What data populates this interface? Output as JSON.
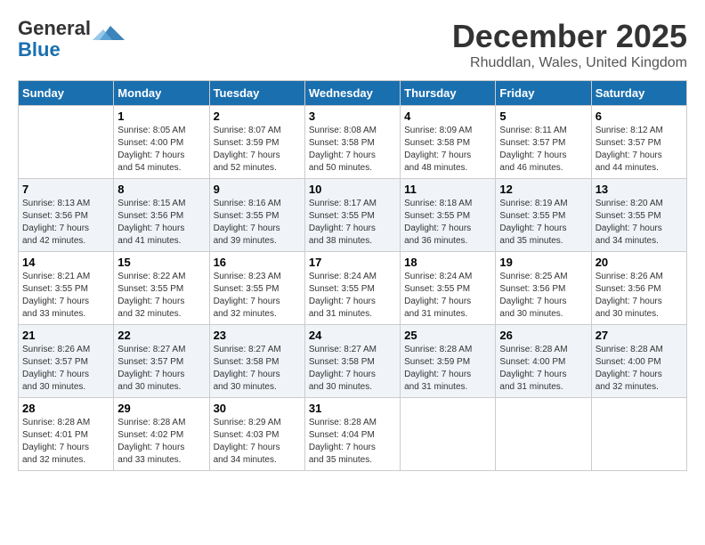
{
  "header": {
    "logo_line1": "General",
    "logo_line2": "Blue",
    "title": "December 2025",
    "subtitle": "Rhuddlan, Wales, United Kingdom"
  },
  "days_of_week": [
    "Sunday",
    "Monday",
    "Tuesday",
    "Wednesday",
    "Thursday",
    "Friday",
    "Saturday"
  ],
  "weeks": [
    [
      {
        "num": "",
        "info": ""
      },
      {
        "num": "1",
        "info": "Sunrise: 8:05 AM\nSunset: 4:00 PM\nDaylight: 7 hours\nand 54 minutes."
      },
      {
        "num": "2",
        "info": "Sunrise: 8:07 AM\nSunset: 3:59 PM\nDaylight: 7 hours\nand 52 minutes."
      },
      {
        "num": "3",
        "info": "Sunrise: 8:08 AM\nSunset: 3:58 PM\nDaylight: 7 hours\nand 50 minutes."
      },
      {
        "num": "4",
        "info": "Sunrise: 8:09 AM\nSunset: 3:58 PM\nDaylight: 7 hours\nand 48 minutes."
      },
      {
        "num": "5",
        "info": "Sunrise: 8:11 AM\nSunset: 3:57 PM\nDaylight: 7 hours\nand 46 minutes."
      },
      {
        "num": "6",
        "info": "Sunrise: 8:12 AM\nSunset: 3:57 PM\nDaylight: 7 hours\nand 44 minutes."
      }
    ],
    [
      {
        "num": "7",
        "info": "Sunrise: 8:13 AM\nSunset: 3:56 PM\nDaylight: 7 hours\nand 42 minutes."
      },
      {
        "num": "8",
        "info": "Sunrise: 8:15 AM\nSunset: 3:56 PM\nDaylight: 7 hours\nand 41 minutes."
      },
      {
        "num": "9",
        "info": "Sunrise: 8:16 AM\nSunset: 3:55 PM\nDaylight: 7 hours\nand 39 minutes."
      },
      {
        "num": "10",
        "info": "Sunrise: 8:17 AM\nSunset: 3:55 PM\nDaylight: 7 hours\nand 38 minutes."
      },
      {
        "num": "11",
        "info": "Sunrise: 8:18 AM\nSunset: 3:55 PM\nDaylight: 7 hours\nand 36 minutes."
      },
      {
        "num": "12",
        "info": "Sunrise: 8:19 AM\nSunset: 3:55 PM\nDaylight: 7 hours\nand 35 minutes."
      },
      {
        "num": "13",
        "info": "Sunrise: 8:20 AM\nSunset: 3:55 PM\nDaylight: 7 hours\nand 34 minutes."
      }
    ],
    [
      {
        "num": "14",
        "info": "Sunrise: 8:21 AM\nSunset: 3:55 PM\nDaylight: 7 hours\nand 33 minutes."
      },
      {
        "num": "15",
        "info": "Sunrise: 8:22 AM\nSunset: 3:55 PM\nDaylight: 7 hours\nand 32 minutes."
      },
      {
        "num": "16",
        "info": "Sunrise: 8:23 AM\nSunset: 3:55 PM\nDaylight: 7 hours\nand 32 minutes."
      },
      {
        "num": "17",
        "info": "Sunrise: 8:24 AM\nSunset: 3:55 PM\nDaylight: 7 hours\nand 31 minutes."
      },
      {
        "num": "18",
        "info": "Sunrise: 8:24 AM\nSunset: 3:55 PM\nDaylight: 7 hours\nand 31 minutes."
      },
      {
        "num": "19",
        "info": "Sunrise: 8:25 AM\nSunset: 3:56 PM\nDaylight: 7 hours\nand 30 minutes."
      },
      {
        "num": "20",
        "info": "Sunrise: 8:26 AM\nSunset: 3:56 PM\nDaylight: 7 hours\nand 30 minutes."
      }
    ],
    [
      {
        "num": "21",
        "info": "Sunrise: 8:26 AM\nSunset: 3:57 PM\nDaylight: 7 hours\nand 30 minutes."
      },
      {
        "num": "22",
        "info": "Sunrise: 8:27 AM\nSunset: 3:57 PM\nDaylight: 7 hours\nand 30 minutes."
      },
      {
        "num": "23",
        "info": "Sunrise: 8:27 AM\nSunset: 3:58 PM\nDaylight: 7 hours\nand 30 minutes."
      },
      {
        "num": "24",
        "info": "Sunrise: 8:27 AM\nSunset: 3:58 PM\nDaylight: 7 hours\nand 30 minutes."
      },
      {
        "num": "25",
        "info": "Sunrise: 8:28 AM\nSunset: 3:59 PM\nDaylight: 7 hours\nand 31 minutes."
      },
      {
        "num": "26",
        "info": "Sunrise: 8:28 AM\nSunset: 4:00 PM\nDaylight: 7 hours\nand 31 minutes."
      },
      {
        "num": "27",
        "info": "Sunrise: 8:28 AM\nSunset: 4:00 PM\nDaylight: 7 hours\nand 32 minutes."
      }
    ],
    [
      {
        "num": "28",
        "info": "Sunrise: 8:28 AM\nSunset: 4:01 PM\nDaylight: 7 hours\nand 32 minutes."
      },
      {
        "num": "29",
        "info": "Sunrise: 8:28 AM\nSunset: 4:02 PM\nDaylight: 7 hours\nand 33 minutes."
      },
      {
        "num": "30",
        "info": "Sunrise: 8:29 AM\nSunset: 4:03 PM\nDaylight: 7 hours\nand 34 minutes."
      },
      {
        "num": "31",
        "info": "Sunrise: 8:28 AM\nSunset: 4:04 PM\nDaylight: 7 hours\nand 35 minutes."
      },
      {
        "num": "",
        "info": ""
      },
      {
        "num": "",
        "info": ""
      },
      {
        "num": "",
        "info": ""
      }
    ]
  ]
}
